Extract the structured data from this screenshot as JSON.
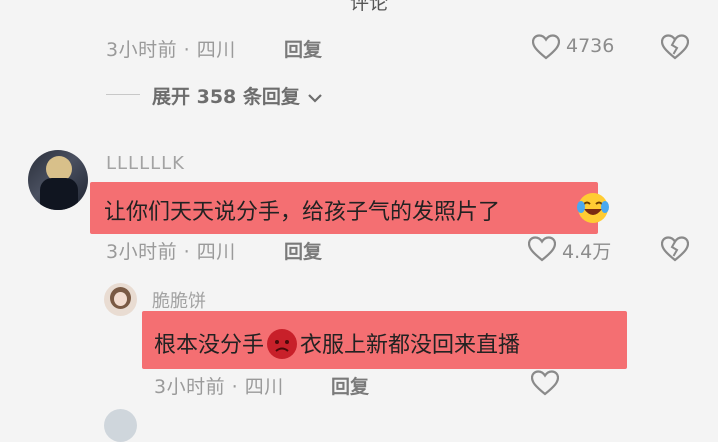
{
  "top_partial_text": "评论",
  "comment0": {
    "meta": "3小时前 · 四川",
    "reply_label": "回复",
    "like_count": "4736",
    "expand_label": "展开 358 条回复"
  },
  "comment1": {
    "username": "LLLLLLK",
    "text": "让你们天天说分手，给孩子气的发照片了",
    "meta": "3小时前 · 四川",
    "reply_label": "回复",
    "like_count": "4.4万"
  },
  "reply1": {
    "username": "脆脆饼",
    "text_before": "根本没分手",
    "text_after": "衣服上新都没回来直播",
    "meta": "3小时前 · 四川",
    "reply_label": "回复"
  },
  "colors": {
    "background": "#f4f4f4",
    "highlight": "#f46f72"
  }
}
